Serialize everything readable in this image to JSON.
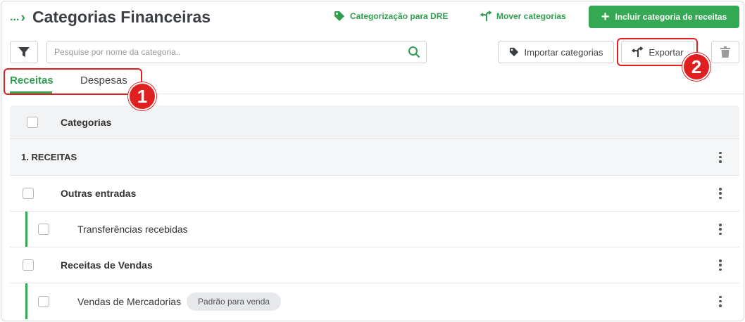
{
  "header": {
    "breadcrumb": "...",
    "title": "Categorias Financeiras",
    "dre_link": "Categorização para DRE",
    "move_link": "Mover categorias",
    "add_button": "Incluir categoria de receitas"
  },
  "toolbar": {
    "search_placeholder": "Pesquise por nome da categoria..",
    "import_button": "Importar categorias",
    "export_button": "Exportar"
  },
  "tabs": [
    {
      "label": "Receitas",
      "active": true
    },
    {
      "label": "Despesas",
      "active": false
    }
  ],
  "callouts": [
    "1",
    "2"
  ],
  "table": {
    "header": "Categorias",
    "group": "1. RECEITAS",
    "rows": [
      {
        "label": "Outras entradas",
        "level": "parent"
      },
      {
        "label": "Transferências recebidas",
        "level": "child"
      },
      {
        "label": "Receitas de Vendas",
        "level": "parent"
      },
      {
        "label": "Vendas de Mercadorias",
        "level": "child",
        "badge": "Padrão para venda"
      }
    ]
  },
  "colors": {
    "accent": "#34a853",
    "callout": "#e02020"
  },
  "icons": [
    "filter-icon",
    "search-icon",
    "tag-icon",
    "move-icon",
    "plus-icon",
    "trash-icon",
    "kebab-icon"
  ]
}
